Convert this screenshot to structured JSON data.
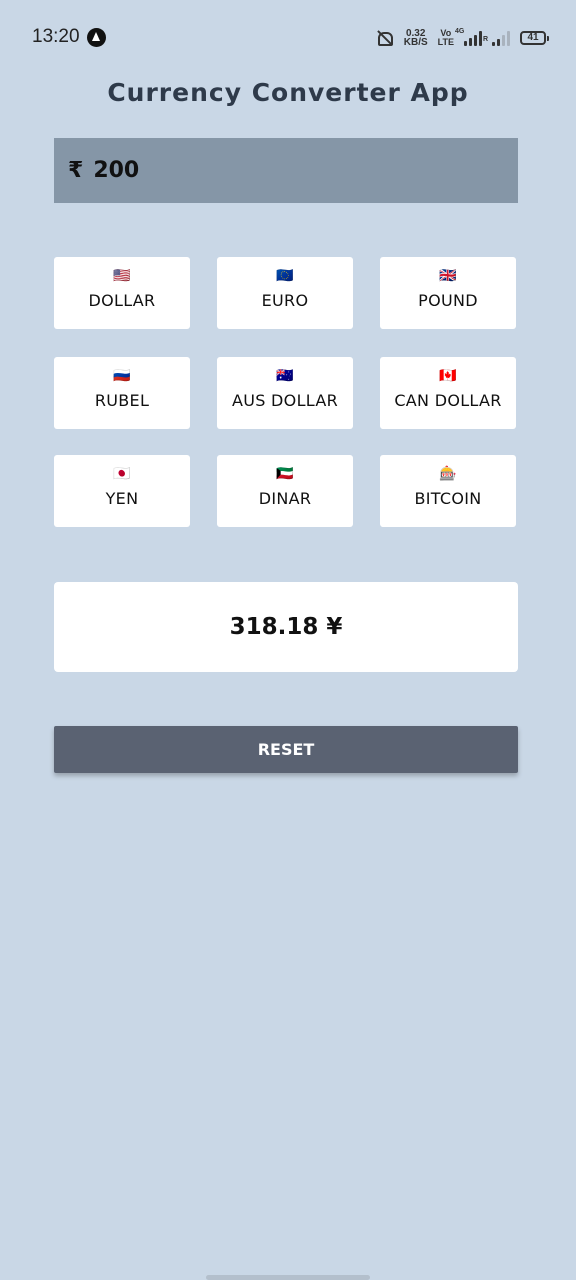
{
  "status_bar": {
    "time": "13:20",
    "net_speed_value": "0.32",
    "net_speed_unit": "KB/S",
    "volte_top": "Vo",
    "volte_bottom": "LTE",
    "signal1_label": "4G",
    "signal2_label": "R",
    "battery": "41"
  },
  "app": {
    "title": "Currency Converter App",
    "input": {
      "symbol": "₹",
      "value": "200"
    },
    "currencies": [
      {
        "flag": "🇺🇸",
        "label": "DOLLAR"
      },
      {
        "flag": "🇪🇺",
        "label": "EURO"
      },
      {
        "flag": "🇬🇧",
        "label": "POUND"
      },
      {
        "flag": "🇷🇺",
        "label": "RUBEL"
      },
      {
        "flag": "🇦🇺",
        "label": "AUS DOLLAR"
      },
      {
        "flag": "🇨🇦",
        "label": "CAN DOLLAR"
      },
      {
        "flag": "🇯🇵",
        "label": "YEN"
      },
      {
        "flag": "🇰🇼",
        "label": "DINAR"
      },
      {
        "flag": "🎰",
        "label": "BITCOIN"
      }
    ],
    "result": "318.18 ¥",
    "reset_label": "RESET"
  },
  "colors": {
    "background": "#c9d7e6",
    "input_bg": "#8596a7",
    "reset_bg": "#5a6272",
    "title": "#2e3a4a"
  }
}
